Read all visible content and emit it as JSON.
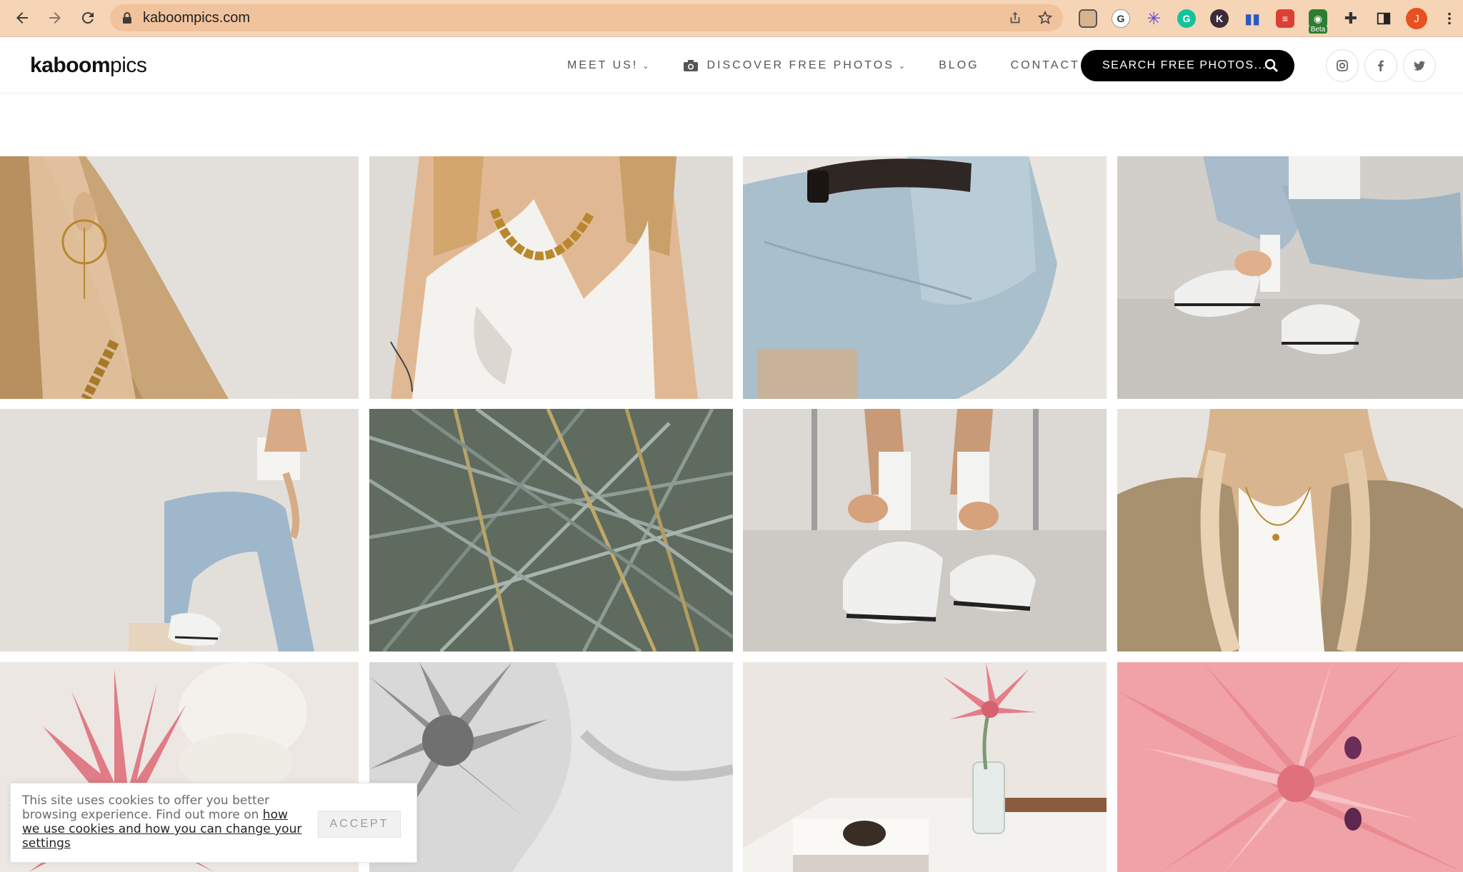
{
  "browser": {
    "url": "kaboompics.com",
    "profile_initial": "J",
    "beta_badge": "Beta",
    "accent_color": "#f6d4b6"
  },
  "site": {
    "logo_bold": "kaboom",
    "logo_light": "pics",
    "nav": {
      "meet_us": "MEET US!",
      "discover": "DISCOVER FREE PHOTOS",
      "blog": "BLOG",
      "contact": "CONTACT"
    },
    "search_label": "SEARCH FREE PHOTOS...",
    "social": [
      "instagram-icon",
      "facebook-icon",
      "twitter-icon"
    ]
  },
  "gallery": {
    "photos": [
      {
        "subject": "Woman with gold hoop earring and chain necklace"
      },
      {
        "subject": "Woman in white one-shoulder top with gold chain"
      },
      {
        "subject": "Light blue jeans with black belt, seated"
      },
      {
        "subject": "Person tying white sneakers, sitting on floor"
      },
      {
        "subject": "Woman in jeans posing on wooden stool"
      },
      {
        "subject": "Green and brown grass blades"
      },
      {
        "subject": "Hands tying white sneaker laces by chair"
      },
      {
        "subject": "Woman in beige blazer with pendant necklace"
      },
      {
        "subject": "Pink bromeliad flower with white vase"
      },
      {
        "subject": "Black and white bromeliad flower on fabric"
      },
      {
        "subject": "Pink flower in glass vase on table with books"
      },
      {
        "subject": "Close-up of pink bromeliad flower"
      }
    ]
  },
  "cookie": {
    "text_prefix": "This site uses cookies to offer you better browsing experience. Find out more on ",
    "link_text": "how we use cookies and how you can change your settings",
    "accept_label": "ACCEPT"
  }
}
